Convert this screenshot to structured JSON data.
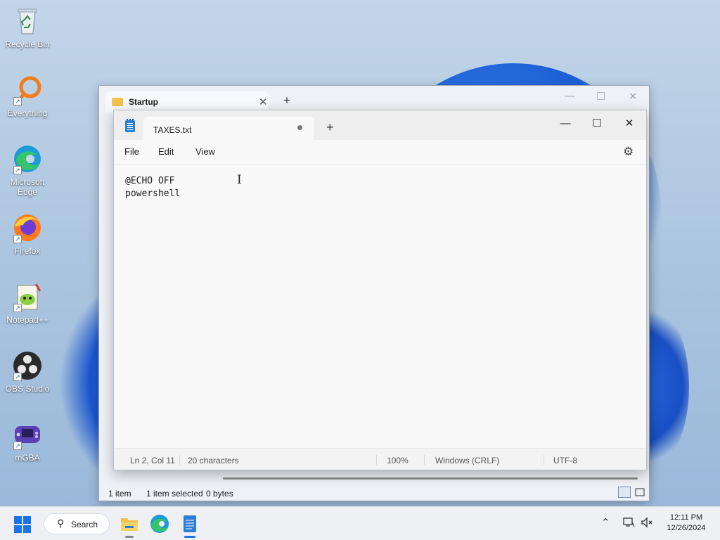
{
  "desktop_icons": [
    {
      "label": "Recycle Bin",
      "icon": "recycle-bin-icon"
    },
    {
      "label": "Everything",
      "icon": "everything-search-icon"
    },
    {
      "label": "Microsoft Edge",
      "icon": "edge-icon"
    },
    {
      "label": "Firefox",
      "icon": "firefox-icon"
    },
    {
      "label": "Notepad++",
      "icon": "notepad-plus-plus-icon"
    },
    {
      "label": "OBS Studio",
      "icon": "obs-studio-icon"
    },
    {
      "label": "mGBA",
      "icon": "mgba-icon"
    }
  ],
  "explorer": {
    "tab_title": "Startup",
    "close_glyph": "✕",
    "new_tab_glyph": "+",
    "minimize_glyph": "—",
    "maximize_glyph": "☐",
    "close_window_glyph": "✕",
    "status_items": "1 item",
    "status_selected": "1 item selected",
    "status_size": "0 bytes"
  },
  "notepad": {
    "tab_title": "TAXES.txt",
    "new_tab_glyph": "+",
    "minimize_glyph": "—",
    "maximize_glyph": "☐",
    "close_glyph": "✕",
    "menu": {
      "file": "File",
      "edit": "Edit",
      "view": "View"
    },
    "settings_glyph": "⚙",
    "lines": [
      "@ECHO OFF",
      "powershell"
    ],
    "cursor_glyph": "I",
    "status": {
      "position": "Ln 2, Col 11",
      "characters": "20 characters",
      "zoom": "100%",
      "line_ending": "Windows (CRLF)",
      "encoding": "UTF-8"
    }
  },
  "taskbar": {
    "search_label": "Search",
    "search_glyph": "⚲",
    "chevron_glyph": "⌃",
    "apps": [
      "file-explorer-icon",
      "edge-icon",
      "notepad-icon"
    ],
    "time": "12:11 PM",
    "date": "12/26/2024"
  },
  "colors": {
    "accent": "#1a73e8",
    "notepad_icon": "#2b7fd4",
    "folder": "#f3c24a"
  }
}
